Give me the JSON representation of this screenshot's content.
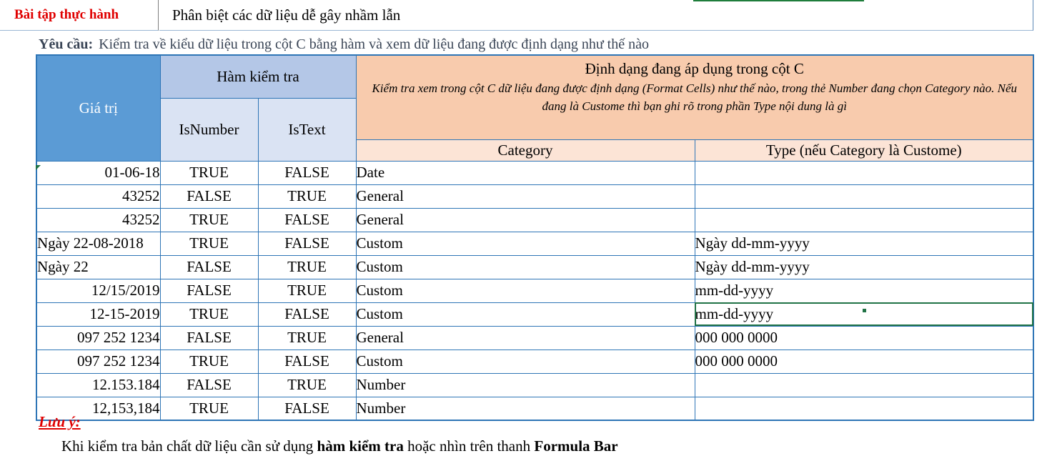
{
  "header": {
    "exercise_label": "Bài tập thực hành",
    "exercise_title": "Phân biệt các dữ liệu dễ gây nhầm lẫn"
  },
  "requirement": {
    "label": "Yêu cầu:",
    "text": "Kiểm tra về kiểu dữ liệu trong cột C bằng hàm và xem dữ liệu đang được định dạng như thế nào"
  },
  "table": {
    "col_value": "Giá trị",
    "col_check_group": "Hàm kiểm tra",
    "col_isnumber": "IsNumber",
    "col_istext": "IsText",
    "col_format_title": "Định dạng đang áp dụng trong cột C",
    "col_format_desc": "Kiểm tra xem trong cột C dữ liệu đang được định dạng (Format Cells) như thế nào, trong thẻ Number đang chọn Category nào. Nếu đang là Custome thì bạn ghi rõ trong phần Type nội dung là gì",
    "col_category": "Category",
    "col_type": "Type (nếu Category là Custome)",
    "rows": [
      {
        "value": "01-06-18",
        "align": "r",
        "isnumber": "TRUE",
        "istext": "FALSE",
        "category": "Date",
        "type": ""
      },
      {
        "value": "43252",
        "align": "r",
        "isnumber": "FALSE",
        "istext": "TRUE",
        "category": "General",
        "type": ""
      },
      {
        "value": "43252",
        "align": "r",
        "isnumber": "TRUE",
        "istext": "FALSE",
        "category": "General",
        "type": ""
      },
      {
        "value": "Ngày 22-08-2018",
        "align": "l",
        "isnumber": "TRUE",
        "istext": "FALSE",
        "category": "Custom",
        "type": "Ngày dd-mm-yyyy"
      },
      {
        "value": "Ngày 22",
        "align": "l",
        "isnumber": "FALSE",
        "istext": "TRUE",
        "category": "Custom",
        "type": "Ngày dd-mm-yyyy"
      },
      {
        "value": "12/15/2019",
        "align": "r",
        "isnumber": "FALSE",
        "istext": "TRUE",
        "category": "Custom",
        "type": "mm-dd-yyyy"
      },
      {
        "value": "12-15-2019",
        "align": "r",
        "isnumber": "TRUE",
        "istext": "FALSE",
        "category": "Custom",
        "type": "mm-dd-yyyy"
      },
      {
        "value": "097 252 1234",
        "align": "r",
        "isnumber": "FALSE",
        "istext": "TRUE",
        "category": "General",
        "type": "000 000 0000"
      },
      {
        "value": "097 252 1234",
        "align": "r",
        "isnumber": "TRUE",
        "istext": "FALSE",
        "category": "Custom",
        "type": "000 000 0000"
      },
      {
        "value": "12.153.184",
        "align": "r",
        "isnumber": "FALSE",
        "istext": "TRUE",
        "category": "Number",
        "type": ""
      },
      {
        "value": "12,153,184",
        "align": "r",
        "isnumber": "TRUE",
        "istext": "FALSE",
        "category": "Number",
        "type": ""
      }
    ]
  },
  "note": {
    "title": "Lưu ý:",
    "text_before": "Khi kiểm tra bản chất dữ liệu cần sử dụng ",
    "bold1": "hàm kiểm tra",
    "text_middle": " hoặc nhìn trên thanh ",
    "bold2": "Formula Bar"
  }
}
